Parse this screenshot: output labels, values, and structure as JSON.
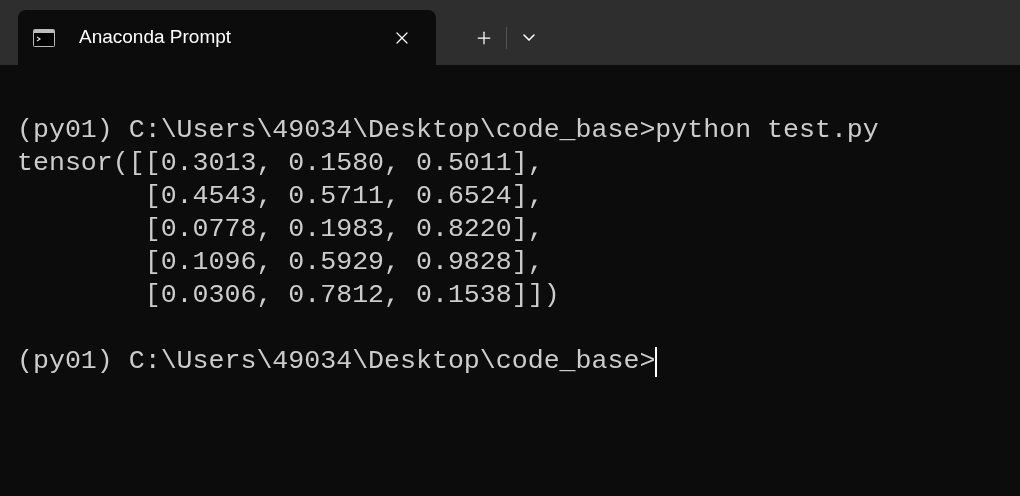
{
  "tabs": [
    {
      "title": "Anaconda Prompt",
      "selected": true
    }
  ],
  "terminal": {
    "cursor": true,
    "lines": [
      {
        "kind": "blank"
      },
      {
        "kind": "text",
        "text": "(py01) C:\\Users\\49034\\Desktop\\code_base>python test.py"
      },
      {
        "kind": "text",
        "text": "tensor([[0.3013, 0.1580, 0.5011],"
      },
      {
        "kind": "text",
        "text": "        [0.4543, 0.5711, 0.6524],"
      },
      {
        "kind": "text",
        "text": "        [0.0778, 0.1983, 0.8220],"
      },
      {
        "kind": "text",
        "text": "        [0.1096, 0.5929, 0.9828],"
      },
      {
        "kind": "text",
        "text": "        [0.0306, 0.7812, 0.1538]])"
      },
      {
        "kind": "blank"
      },
      {
        "kind": "text",
        "text": "(py01) C:\\Users\\49034\\Desktop\\code_base>"
      }
    ]
  }
}
